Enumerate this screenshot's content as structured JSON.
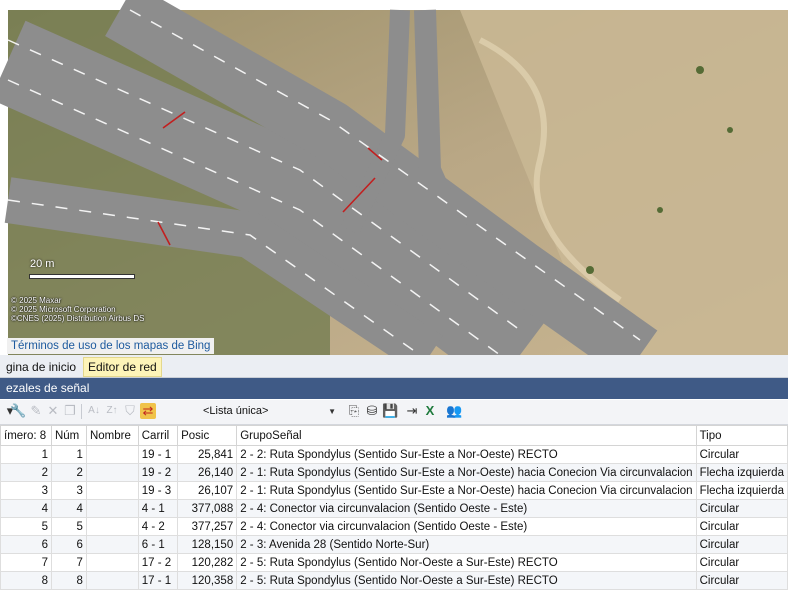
{
  "map": {
    "scale_label": "20 m",
    "credits": [
      "© 2025 Maxar",
      "© 2025 Microsoft Corporation",
      "©CNES (2025) Distribution Airbus DS"
    ],
    "terms_link": "Términos de uso de los mapas de Bing"
  },
  "tabs": [
    {
      "label": "gina de inicio",
      "active": false
    },
    {
      "label": "Editor de red",
      "active": true
    }
  ],
  "panel": {
    "title": "ezales de señal"
  },
  "toolbar": {
    "icons": [
      "wrench-icon",
      "edit-icon",
      "delete-icon",
      "copy-icon",
      "sort-ascending-icon",
      "sort-descending-icon",
      "filter-clear-icon",
      "sync-icon",
      "copy-table-icon",
      "database-icon",
      "save-icon",
      "export-icon",
      "excel-icon",
      "users-icon"
    ],
    "list_selector": "<Lista única>"
  },
  "table": {
    "columns": [
      "ímero: 8",
      "Núm",
      "Nombre",
      "Carril",
      "Posic",
      "GrupoSeñal",
      "Tipo"
    ],
    "rows": [
      {
        "count": "1",
        "num": "1",
        "nombre": "",
        "carril": "19 - 1",
        "posic": "25,841",
        "grupo": "2 - 2: Ruta Spondylus (Sentido Sur-Este a Nor-Oeste) RECTO",
        "tipo": "Circular"
      },
      {
        "count": "2",
        "num": "2",
        "nombre": "",
        "carril": "19 - 2",
        "posic": "26,140",
        "grupo": "2 - 1: Ruta Spondylus (Sentido Sur-Este a Nor-Oeste) hacia Conecion Via circunvalacion",
        "tipo": "Flecha izquierda"
      },
      {
        "count": "3",
        "num": "3",
        "nombre": "",
        "carril": "19 - 3",
        "posic": "26,107",
        "grupo": "2 - 1: Ruta Spondylus (Sentido Sur-Este a Nor-Oeste) hacia Conecion Via circunvalacion",
        "tipo": "Flecha izquierda"
      },
      {
        "count": "4",
        "num": "4",
        "nombre": "",
        "carril": "4 - 1",
        "posic": "377,088",
        "grupo": "2 - 4: Conector via circunvalacion (Sentido Oeste - Este)",
        "tipo": "Circular"
      },
      {
        "count": "5",
        "num": "5",
        "nombre": "",
        "carril": "4 - 2",
        "posic": "377,257",
        "grupo": "2 - 4: Conector via circunvalacion (Sentido Oeste - Este)",
        "tipo": "Circular"
      },
      {
        "count": "6",
        "num": "6",
        "nombre": "",
        "carril": "6 - 1",
        "posic": "128,150",
        "grupo": "2 - 3: Avenida 28 (Sentido Norte-Sur)",
        "tipo": "Circular"
      },
      {
        "count": "7",
        "num": "7",
        "nombre": "",
        "carril": "17 - 2",
        "posic": "120,282",
        "grupo": "2 - 5: Ruta Spondylus (Sentido  Nor-Oeste a Sur-Este) RECTO",
        "tipo": "Circular"
      },
      {
        "count": "8",
        "num": "8",
        "nombre": "",
        "carril": "17 - 1",
        "posic": "120,358",
        "grupo": "2 - 5: Ruta Spondylus (Sentido  Nor-Oeste a Sur-Este) RECTO",
        "tipo": "Circular"
      }
    ]
  }
}
